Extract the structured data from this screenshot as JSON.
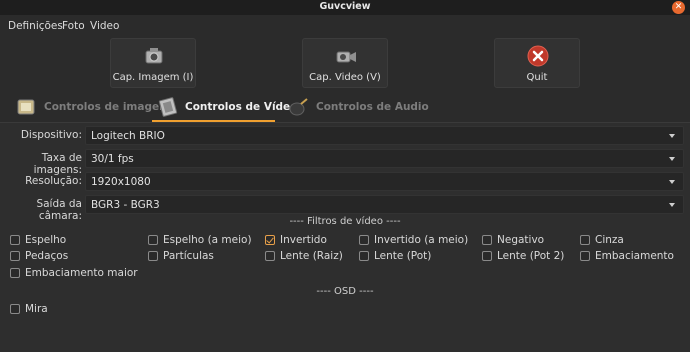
{
  "window": {
    "title": "Guvcview",
    "close_icon": "close-icon"
  },
  "menu": {
    "items": [
      "Definições",
      "Foto",
      "Video"
    ]
  },
  "toolbar": {
    "capture_image": "Cap. Imagem (I)",
    "capture_video": "Cap. Video (V)",
    "quit": "Quit"
  },
  "tabs": [
    {
      "label": "Controlos de imagem",
      "active": false
    },
    {
      "label": "Controlos de Vídeo",
      "active": true
    },
    {
      "label": "Controlos de Audio",
      "active": false
    }
  ],
  "video": {
    "device_label": "Dispositivo:",
    "device_value": "Logitech BRIO",
    "framerate_label": "Taxa de imagens:",
    "framerate_value": "30/1 fps",
    "resolution_label": "Resolução:",
    "resolution_value": "1920x1080",
    "output_label": "Saída da câmara:",
    "output_value": "BGR3 - BGR3"
  },
  "filters": {
    "title": "---- Filtros de vídeo ----",
    "items": [
      {
        "label": "Espelho",
        "checked": false
      },
      {
        "label": "Espelho (a meio)",
        "checked": false
      },
      {
        "label": "Invertido",
        "checked": true
      },
      {
        "label": "Invertido (a meio)",
        "checked": false
      },
      {
        "label": "Negativo",
        "checked": false
      },
      {
        "label": "Cinza",
        "checked": false
      },
      {
        "label": "Pedaços",
        "checked": false
      },
      {
        "label": "Partículas",
        "checked": false
      },
      {
        "label": "Lente (Raiz)",
        "checked": false
      },
      {
        "label": "Lente (Pot)",
        "checked": false
      },
      {
        "label": "Lente (Pot 2)",
        "checked": false
      },
      {
        "label": "Embaciamento",
        "checked": false
      },
      {
        "label": "Embaciamento maior",
        "checked": false
      }
    ]
  },
  "osd": {
    "title": "---- OSD ----",
    "items": [
      {
        "label": "Mira",
        "checked": false
      }
    ]
  },
  "colors": {
    "accent": "#f0a030",
    "quit_red": "#c0392b"
  }
}
